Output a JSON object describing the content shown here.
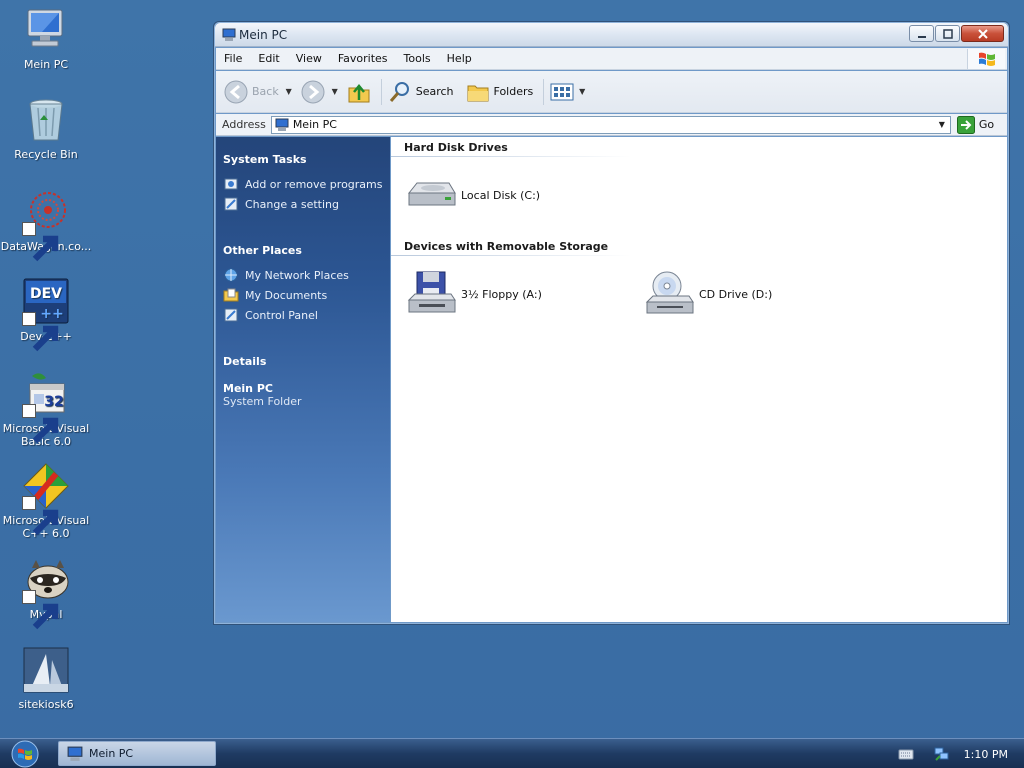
{
  "desktop": {
    "icons": [
      {
        "label": "Mein PC",
        "icon": "my-computer-icon"
      },
      {
        "label": "Recycle Bin",
        "icon": "recycle-bin-icon"
      },
      {
        "label": "DataWagon.co...",
        "icon": "datawagon-icon"
      },
      {
        "label": "Dev-C++",
        "icon": "dev-cpp-icon"
      },
      {
        "label": "Microsoft Visual Basic 6.0",
        "icon": "visual-basic-icon"
      },
      {
        "label": "Microsoft Visual C++ 6.0",
        "icon": "visual-cpp-icon"
      },
      {
        "label": "Mypal",
        "icon": "mypal-icon"
      },
      {
        "label": "sitekiosk6",
        "icon": "sitekiosk-icon"
      }
    ]
  },
  "window": {
    "title": "Mein PC",
    "menu": [
      "File",
      "Edit",
      "View",
      "Favorites",
      "Tools",
      "Help"
    ],
    "toolbar": {
      "back": "Back",
      "search": "Search",
      "folders": "Folders"
    },
    "address": {
      "label": "Address",
      "value": "Mein PC",
      "go": "Go"
    },
    "side": {
      "system_tasks": {
        "title": "System Tasks",
        "links": [
          "Add or remove programs",
          "Change a setting"
        ]
      },
      "other_places": {
        "title": "Other Places",
        "links": [
          "My Network Places",
          "My Documents",
          "Control Panel"
        ]
      },
      "details": {
        "title": "Details",
        "name": "Mein PC",
        "type": "System Folder"
      }
    },
    "sections": [
      {
        "title": "Hard Disk Drives",
        "items": [
          {
            "label": "Local Disk (C:)",
            "icon": "hard-disk-icon"
          }
        ]
      },
      {
        "title": "Devices with Removable Storage",
        "items": [
          {
            "label": "3½ Floppy (A:)",
            "icon": "floppy-drive-icon"
          },
          {
            "label": "CD Drive (D:)",
            "icon": "cd-drive-icon"
          }
        ]
      }
    ]
  },
  "taskbar": {
    "task": "Mein PC",
    "clock": "1:10 PM"
  },
  "colors": {
    "desktop": "#3b6fa6",
    "side_panel_top": "#24457a",
    "side_panel_bottom": "#6a98cf",
    "close_button": "#c9513a"
  }
}
